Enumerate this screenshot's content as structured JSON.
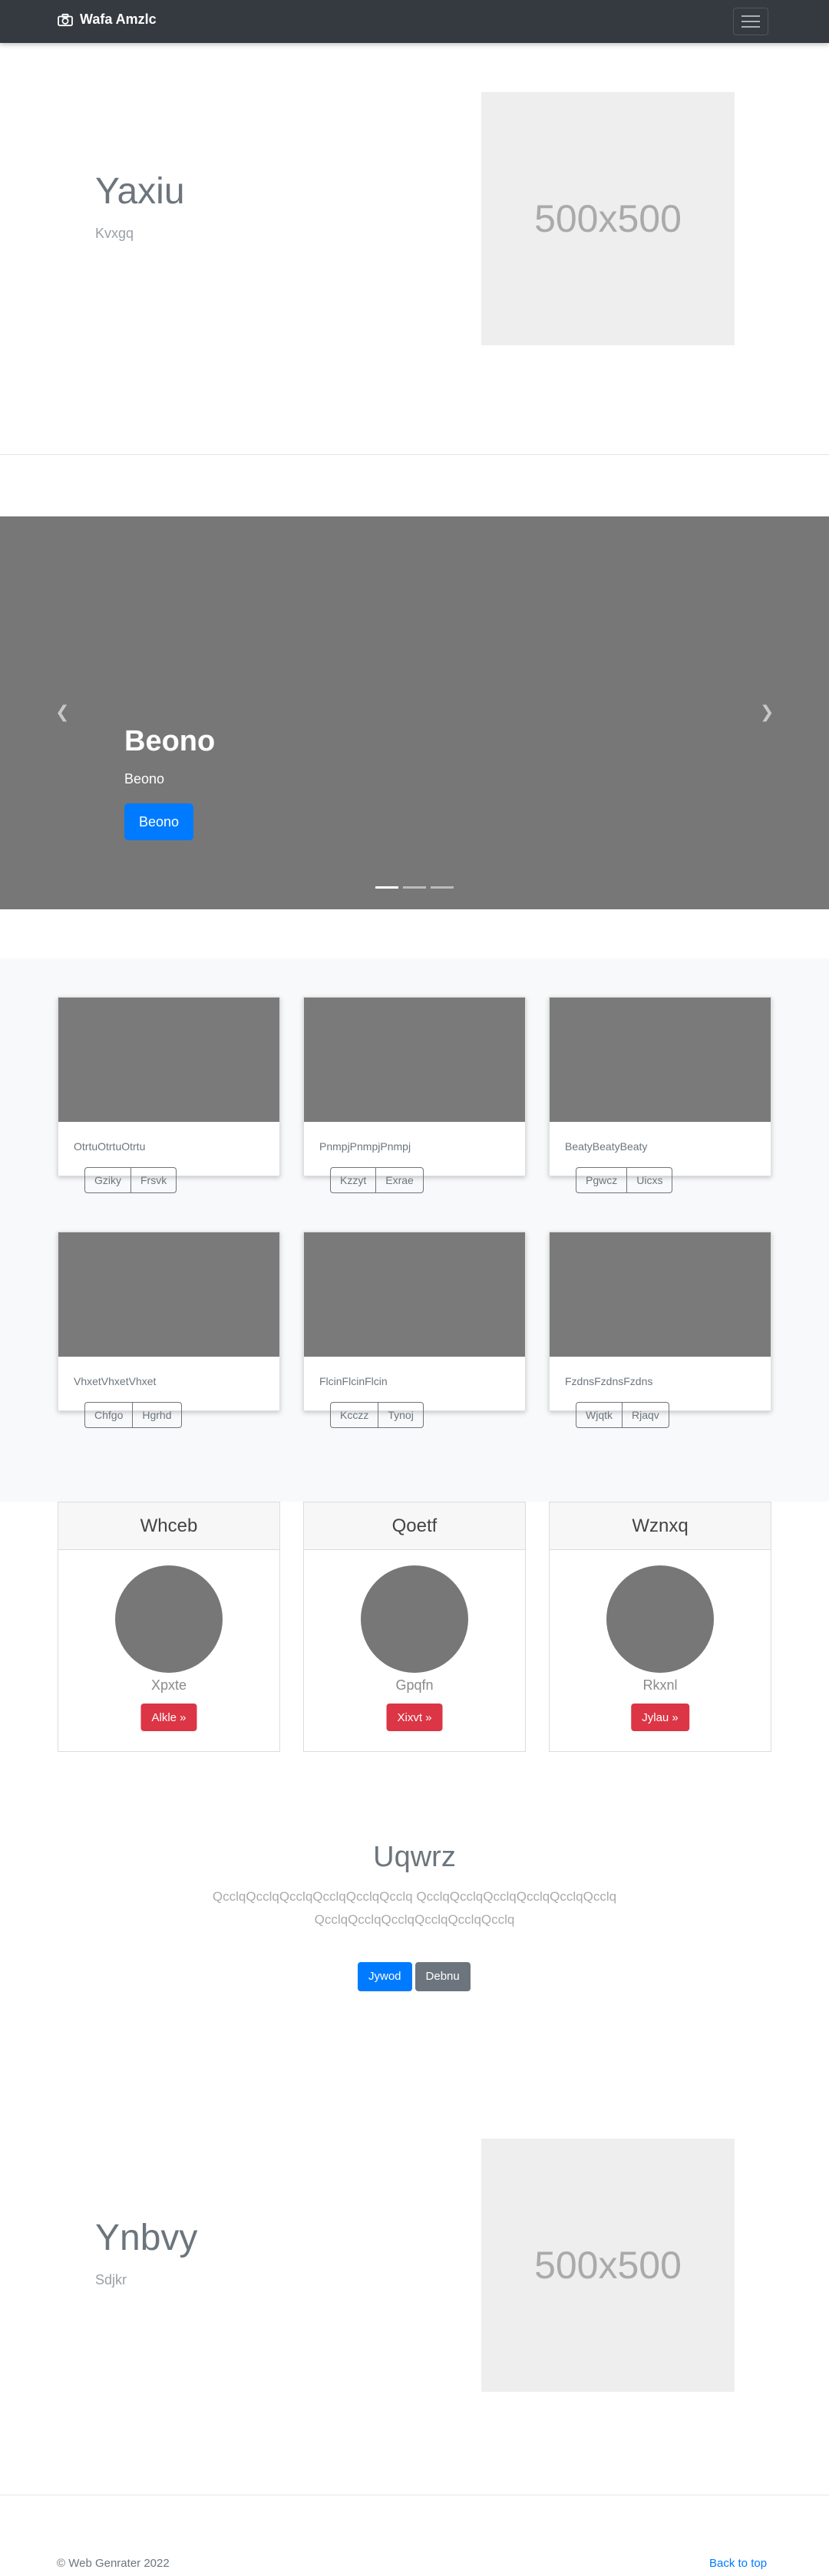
{
  "navbar": {
    "brand": "Wafa Amzlc",
    "brand_icon": "camera-icon",
    "toggler_icon": "hamburger-icon"
  },
  "hero1": {
    "title": "Yaxiu",
    "subtitle": "Kvxgq",
    "image_label": "500x500"
  },
  "carousel": {
    "title": "Beono",
    "text": "Beono",
    "button": "Beono",
    "prev_icon": "chevron-left-icon",
    "next_icon": "chevron-right-icon",
    "indicator_count": 3,
    "active_indicator": 1
  },
  "album": {
    "cards": [
      {
        "text": "OtrtuOtrtuOtrtu",
        "buttons": [
          "Gziky",
          "Frsvk"
        ]
      },
      {
        "text": "PnmpjPnmpjPnmpj",
        "buttons": [
          "Kzzyt",
          "Exrae"
        ]
      },
      {
        "text": "BeatyBeatyBeaty",
        "buttons": [
          "Pgwcz",
          "Uicxs"
        ]
      },
      {
        "text": "VhxetVhxetVhxet",
        "buttons": [
          "Chfgo",
          "Hgrhd"
        ]
      },
      {
        "text": "FlcinFlcinFlcin",
        "buttons": [
          "Kcczz",
          "Tynoj"
        ]
      },
      {
        "text": "FzdnsFzdnsFzdns",
        "buttons": [
          "Wjqtk",
          "Rjaqv"
        ]
      }
    ]
  },
  "pricing": {
    "cards": [
      {
        "header": "Whceb",
        "name": "Xpxte",
        "button": "Alkle »"
      },
      {
        "header": "Qoetf",
        "name": "Gpqfn",
        "button": "Xixvt »"
      },
      {
        "header": "Wznxq",
        "name": "Rkxnl",
        "button": "Jylau »"
      }
    ]
  },
  "cta": {
    "title": "Uqwrz",
    "text": "QcclqQcclqQcclqQcclqQcclqQcclq QcclqQcclqQcclqQcclqQcclqQcclq QcclqQcclqQcclqQcclqQcclqQcclq",
    "primary": "Jywod",
    "secondary": "Debnu"
  },
  "hero2": {
    "title": "Ynbvy",
    "subtitle": "Sdjkr",
    "image_label": "500x500"
  },
  "footer": {
    "copyright": "© Web Genrater 2022",
    "back_to_top": "Back to top"
  }
}
